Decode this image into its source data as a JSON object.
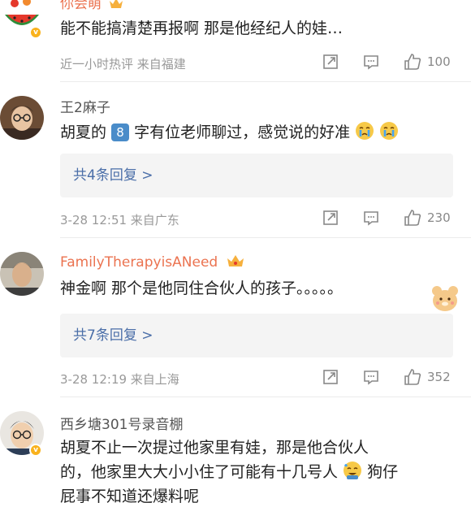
{
  "comments": [
    {
      "username": "你会萌",
      "text": "能不能搞清楚再报啊 那是他经纪人的娃…",
      "meta": "近一小时热评  来自福建",
      "likes": "100"
    },
    {
      "username": "王2麻子",
      "text_before": "胡夏的",
      "badge": "8",
      "text_after": "字有位老师聊过，感觉说的好准",
      "replies": "共4条回复 >",
      "meta": "3-28 12:51  来自广东",
      "likes": "230"
    },
    {
      "username": "FamilyTherapyisANeed",
      "text": "神金啊 那个是他同住合伙人的孩子。。。。。",
      "replies": "共7条回复 >",
      "meta": "3-28 12:19  来自上海",
      "likes": "352"
    },
    {
      "username": "西乡塘301号录音棚",
      "text_line1": "胡夏不止一次提过他家里有娃，那是他合伙人",
      "text_line2a": "的，他家里大大小小住了可能有十几号人",
      "text_line2b": "狗仔",
      "text_line3": "屁事不知道还爆料呢"
    }
  ]
}
